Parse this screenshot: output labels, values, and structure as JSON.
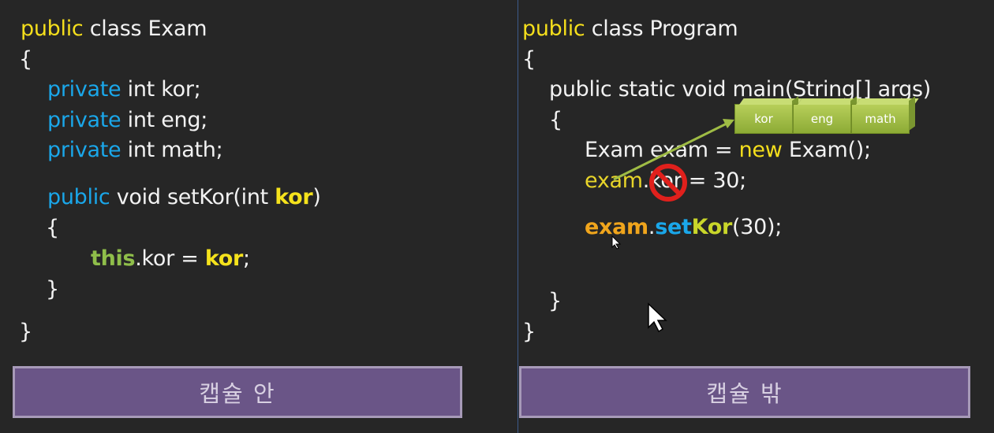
{
  "left": {
    "lines": {
      "l1a": "public",
      "l1b": " class Exam",
      "l2": "{",
      "l3a": "private",
      "l3b": " int kor;",
      "l4a": "private",
      "l4b": " int eng;",
      "l5a": "private",
      "l5b": " int math;",
      "l6a": "public",
      "l6b": " void setKor(int ",
      "l6c": "kor",
      "l6d": ")",
      "l7": "{",
      "l8a": "this",
      "l8b": ".kor = ",
      "l8c": "kor",
      "l8d": ";",
      "l9": "}",
      "l10": "}"
    },
    "caption": "캡슐 안"
  },
  "right": {
    "lines": {
      "r1a": "public",
      "r1b": " class Program",
      "r2": "{",
      "r3": "public static void main(String[] args)",
      "r4": "{",
      "r5a": "Exam exam = ",
      "r5b": "new",
      "r5c": " Exam();",
      "r6a": "exam",
      "r6b": ".kor",
      "r6c": " = 30;",
      "r7a": "exam",
      "r7b": ".",
      "r7c": "set",
      "r7d": "Kor",
      "r7e": "(30);",
      "r8": "}",
      "r9": "}"
    },
    "caption": "캡슐 밖"
  },
  "memory": {
    "kor": "kor",
    "eng": "eng",
    "math": "math"
  },
  "colors": {
    "background": "#262626",
    "caption_bar": "#6a5587",
    "memory_box": "#9fbc45",
    "no_sign": "#e0201c"
  },
  "icons": [
    "no-entry-icon",
    "mouse-cursor-icon"
  ]
}
